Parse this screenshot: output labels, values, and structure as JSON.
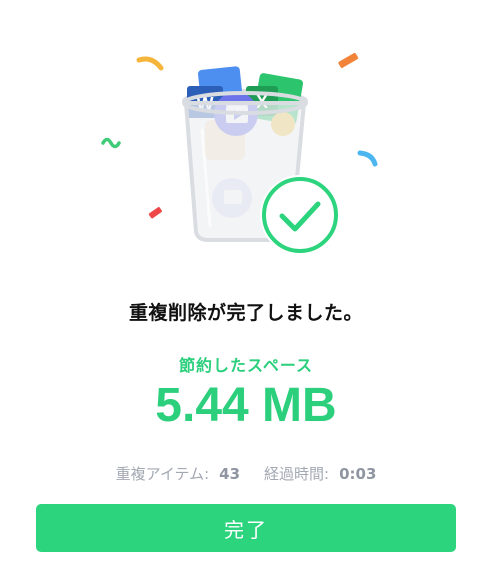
{
  "completion": {
    "title": "重複削除が完了しました。",
    "saved_label": "節約したスペース",
    "saved_value": "5.44 MB"
  },
  "stats": {
    "items_label": "重複アイテム:",
    "items_value": "43",
    "elapsed_label": "経過時間:",
    "elapsed_value": "0:03"
  },
  "actions": {
    "done_label": "完了"
  },
  "icons": {
    "word_letter": "W",
    "excel_letter": "X"
  },
  "colors": {
    "accent": "#2dd47e",
    "word": "#2b5fb8",
    "excel": "#1f9d55",
    "video": "#6d73e8"
  }
}
